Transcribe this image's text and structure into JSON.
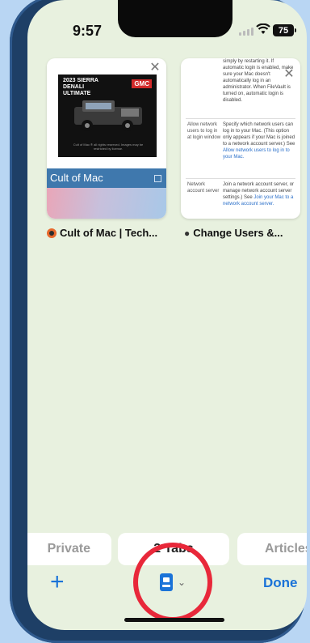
{
  "status_bar": {
    "time": "9:57",
    "battery": "75"
  },
  "tabs": [
    {
      "site_title": "Cult of Mac | Tech...",
      "thumbnail": {
        "ad_title": "2023 SIERRA DENALI ULTIMATE",
        "ad_brand": "GMC",
        "ad_fine_print": "Cult of Mac ® all rights reserved. Images may be restricted by license.",
        "site_bar_text": "Cult of Mac"
      },
      "favicon": "cult-of-mac-icon"
    },
    {
      "site_title": "Change Users &...",
      "thumbnail": {
        "intro_text": "simply by restarting it. If automatic login is enabled, make sure your Mac doesn't automatically log in an administrator. When FileVault is turned on, automatic login is disabled.",
        "row1_label": "Allow network users to log in at login window",
        "row1_text": "Specify which network users can log in to your Mac. (This option only appears if your Mac is joined to a network account server.) See",
        "row1_link": "Allow network users to log in to your Mac.",
        "row2_label": "Network account server",
        "row2_text": "Join a network account server, or manage network account server settings.) See",
        "row2_link": "Join your Mac to a network account server."
      },
      "favicon": "apple-icon"
    }
  ],
  "tab_groups": {
    "private": "Private",
    "tabs": "2 Tabs",
    "articles": "Articles"
  },
  "toolbar": {
    "done_label": "Done"
  },
  "colors": {
    "accent": "#1a73d8",
    "highlight": "#e8283a",
    "background": "#e8f1df"
  }
}
